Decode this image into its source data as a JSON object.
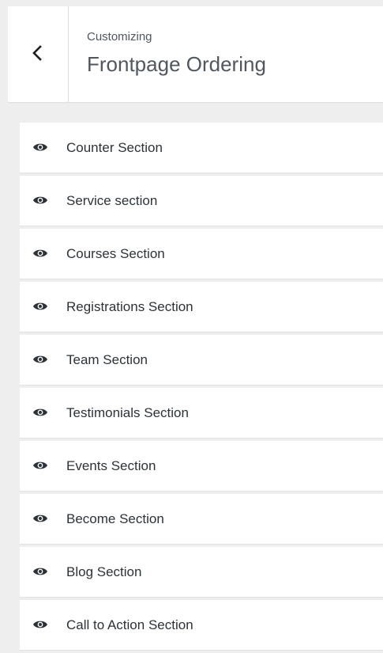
{
  "header": {
    "subtitle": "Customizing",
    "title": "Frontpage Ordering",
    "back_icon": "chevron-left-icon"
  },
  "sections": {
    "icon": "eye-icon",
    "items": [
      {
        "label": "Counter Section"
      },
      {
        "label": "Service section"
      },
      {
        "label": "Courses Section"
      },
      {
        "label": "Registrations Section"
      },
      {
        "label": "Team Section"
      },
      {
        "label": "Testimonials Section"
      },
      {
        "label": "Events Section"
      },
      {
        "label": "Become Section"
      },
      {
        "label": "Blog Section"
      },
      {
        "label": "Call to Action Section"
      }
    ]
  },
  "colors": {
    "background": "#eeeeee",
    "panel": "#ffffff",
    "text": "#2c3338",
    "muted_text": "#50575e",
    "border": "#dcdcde"
  }
}
